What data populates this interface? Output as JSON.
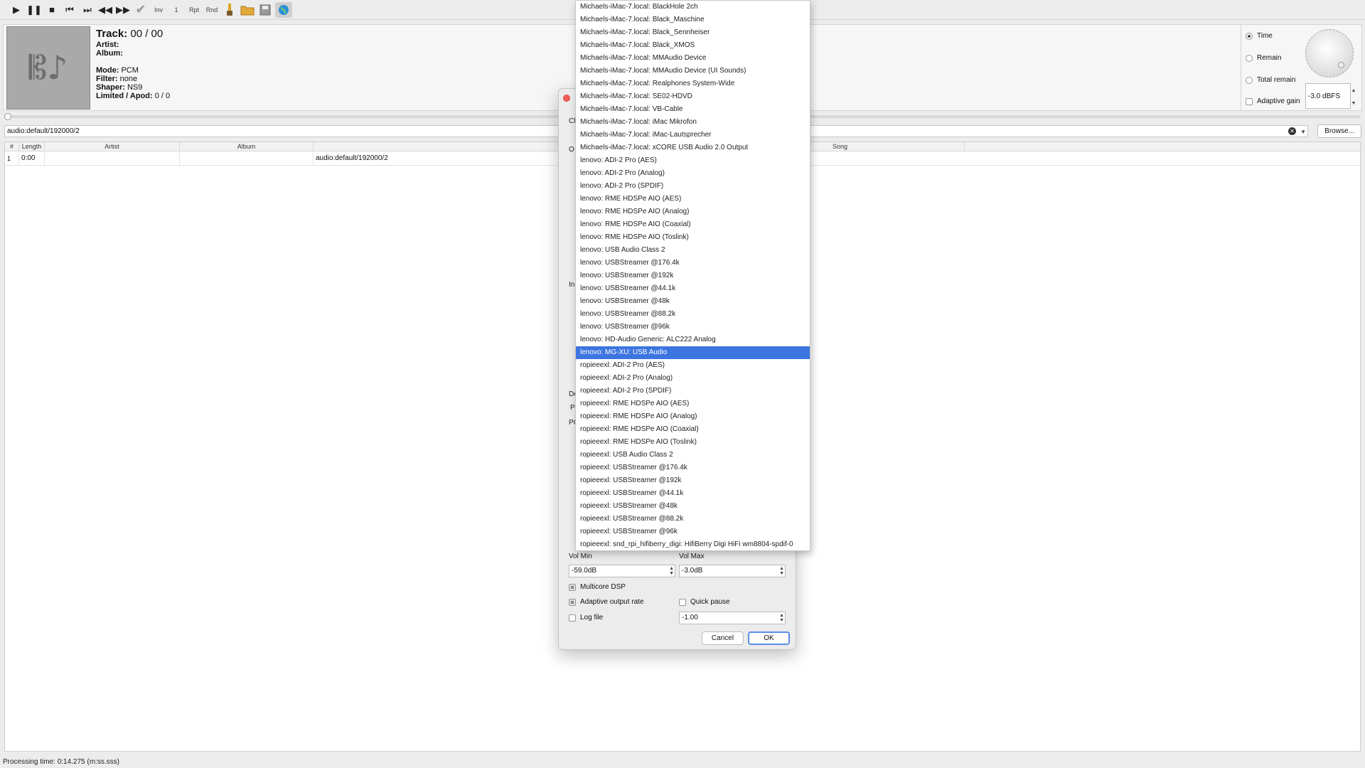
{
  "toolbar": {
    "inv_label": "Inv",
    "one_label": "1",
    "rpt_label": "Rpt",
    "rnd_label": "Rnd"
  },
  "info": {
    "track_label": "Track:",
    "track_value": "00 / 00",
    "artist_label": "Artist:",
    "album_label": "Album:",
    "mode_label": "Mode:",
    "mode_value": "PCM",
    "filter_label": "Filter:",
    "filter_value": "none",
    "shaper_label": "Shaper:",
    "shaper_value": "NS9",
    "limited_label": "Limited / Apod:",
    "limited_value": "0 / 0"
  },
  "right_panel": {
    "time_label": "Time",
    "remain_label": "Remain",
    "total_remain_label": "Total remain",
    "adaptive_gain_label": "Adaptive gain",
    "gain_value": "-3.0 dBFS"
  },
  "pathbar": {
    "value": "audio:default/192000/2",
    "browse_label": "Browse..."
  },
  "table": {
    "headers": {
      "num": "#",
      "length": "Length",
      "artist": "Artist",
      "album": "Album",
      "song": "Song"
    },
    "rows": [
      {
        "num": "1",
        "length": "0:00",
        "artist": "",
        "album": "",
        "path": "audio:default/192000/2"
      }
    ]
  },
  "dialog": {
    "frag_c": "Cl",
    "frag_o": "O",
    "frag_i": "In",
    "frag_d": "De",
    "frag_p": "P",
    "frag_pc": "PC",
    "vol_min_label": "Vol Min",
    "vol_max_label": "Vol Max",
    "vol_min_value": "-59.0dB",
    "vol_max_value": "-3.0dB",
    "multicore_label": "Multicore DSP",
    "adaptive_rate_label": "Adaptive output rate",
    "quick_pause_label": "Quick pause",
    "log_file_label": "Log file",
    "log_value": "-1.00",
    "cancel_label": "Cancel",
    "ok_label": "OK"
  },
  "dropdown": {
    "items": [
      "Michaels-iMac-7.local: BlackHole 2ch",
      "Michaels-iMac-7.local: Black_Maschine",
      "Michaels-iMac-7.local: Black_Sennheiser",
      "Michaels-iMac-7.local: Black_XMOS",
      "Michaels-iMac-7.local: MMAudio Device",
      "Michaels-iMac-7.local: MMAudio Device (UI Sounds)",
      "Michaels-iMac-7.local: Realphones System-Wide",
      "Michaels-iMac-7.local: SE02-HDVD",
      "Michaels-iMac-7.local: VB-Cable",
      "Michaels-iMac-7.local: iMac Mikrofon",
      "Michaels-iMac-7.local: iMac-Lautsprecher",
      "Michaels-iMac-7.local: xCORE USB Audio 2.0 Output",
      "lenovo: ADI-2 Pro (AES)",
      "lenovo: ADI-2 Pro (Analog)",
      "lenovo: ADI-2 Pro (SPDIF)",
      "lenovo: RME HDSPe AIO (AES)",
      "lenovo: RME HDSPe AIO (Analog)",
      "lenovo: RME HDSPe AIO (Coaxial)",
      "lenovo: RME HDSPe AIO (Toslink)",
      "lenovo: USB Audio Class 2",
      "lenovo: USBStreamer @176.4k",
      "lenovo: USBStreamer @192k",
      "lenovo: USBStreamer @44.1k",
      "lenovo: USBStreamer @48k",
      "lenovo: USBStreamer @88.2k",
      "lenovo: USBStreamer @96k",
      "lenovo: HD-Audio Generic: ALC222 Analog",
      "lenovo: MG-XU: USB Audio",
      "ropieeexl: ADI-2 Pro (AES)",
      "ropieeexl: ADI-2 Pro (Analog)",
      "ropieeexl: ADI-2 Pro (SPDIF)",
      "ropieeexl: RME HDSPe AIO (AES)",
      "ropieeexl: RME HDSPe AIO (Analog)",
      "ropieeexl: RME HDSPe AIO (Coaxial)",
      "ropieeexl: RME HDSPe AIO (Toslink)",
      "ropieeexl: USB Audio Class 2",
      "ropieeexl: USBStreamer @176.4k",
      "ropieeexl: USBStreamer @192k",
      "ropieeexl: USBStreamer @44.1k",
      "ropieeexl: USBStreamer @48k",
      "ropieeexl: USBStreamer @88.2k",
      "ropieeexl: USBStreamer @96k",
      "ropieeexl: snd_rpi_hifiberry_digi: HifiBerry Digi HiFi wm8804-spdif-0"
    ],
    "selected": "lenovo: MG-XU: USB Audio"
  },
  "status": {
    "text": "Processing time: 0:14.275 (m:ss.sss)"
  },
  "colors": {
    "selection": "#3d75e0",
    "close": "#f25f57"
  }
}
